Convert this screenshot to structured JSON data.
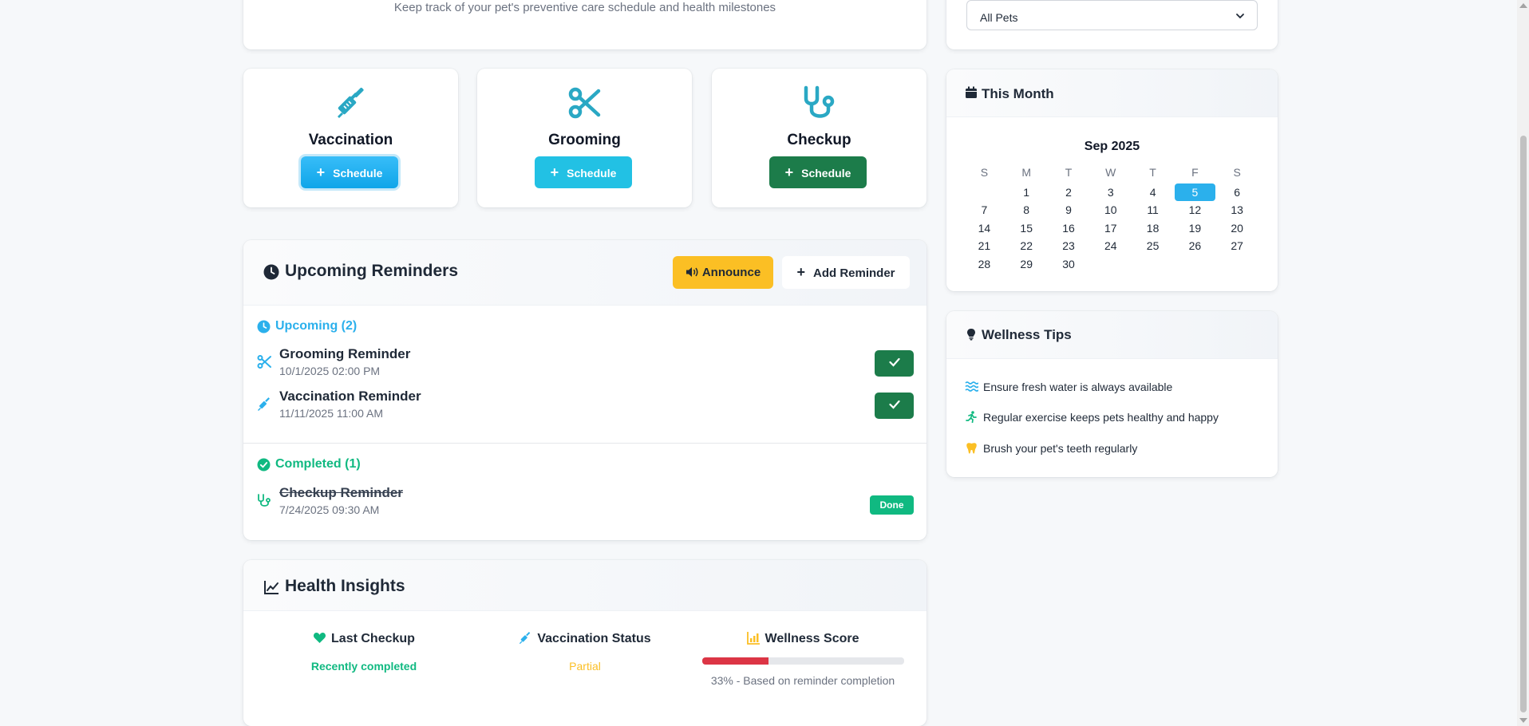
{
  "header": {
    "subtitle": "Keep track of your pet's preventive care schedule and health milestones"
  },
  "filter": {
    "selected": "All Pets"
  },
  "services": [
    {
      "title": "Vaccination",
      "button": "Schedule",
      "icon": "syringe-icon",
      "color": "#2aa8c4"
    },
    {
      "title": "Grooming",
      "button": "Schedule",
      "icon": "scissors-icon",
      "color": "#2aa8c4"
    },
    {
      "title": "Checkup",
      "button": "Schedule",
      "icon": "stethoscope-icon",
      "color": "#2aa8c4"
    }
  ],
  "reminders": {
    "title": "Upcoming Reminders",
    "announce_label": "Announce",
    "add_label": "Add Reminder",
    "upcoming_label": "Upcoming (2)",
    "completed_label": "Completed (1)",
    "upcoming": [
      {
        "title": "Grooming Reminder",
        "date": "10/1/2025 02:00 PM",
        "icon": "scissors-icon"
      },
      {
        "title": "Vaccination Reminder",
        "date": "11/11/2025 11:00 AM",
        "icon": "syringe-icon"
      }
    ],
    "completed": [
      {
        "title": "Checkup Reminder",
        "date": "7/24/2025 09:30 AM",
        "icon": "stethoscope-icon",
        "badge": "Done"
      }
    ]
  },
  "insights": {
    "title": "Health Insights",
    "last_checkup": {
      "label": "Last Checkup",
      "value": "Recently completed",
      "color": "#10b981"
    },
    "vaccination": {
      "label": "Vaccination Status",
      "value": "Partial",
      "color": "#fbbf24"
    },
    "wellness": {
      "label": "Wellness Score",
      "percent": 33,
      "caption": "33% - Based on reminder completion",
      "color": "#dc3545"
    }
  },
  "calendar": {
    "title": "This Month",
    "month": "Sep 2025",
    "weekdays": [
      "S",
      "M",
      "T",
      "W",
      "T",
      "F",
      "S"
    ],
    "first_weekday": 1,
    "days": 30,
    "today": 5
  },
  "tips": {
    "title": "Wellness Tips",
    "items": [
      {
        "text": "Ensure fresh water is always available",
        "icon": "water-icon"
      },
      {
        "text": "Regular exercise keeps pets healthy and happy",
        "icon": "running-icon"
      },
      {
        "text": "Brush your pet's teeth regularly",
        "icon": "tooth-icon"
      }
    ]
  }
}
